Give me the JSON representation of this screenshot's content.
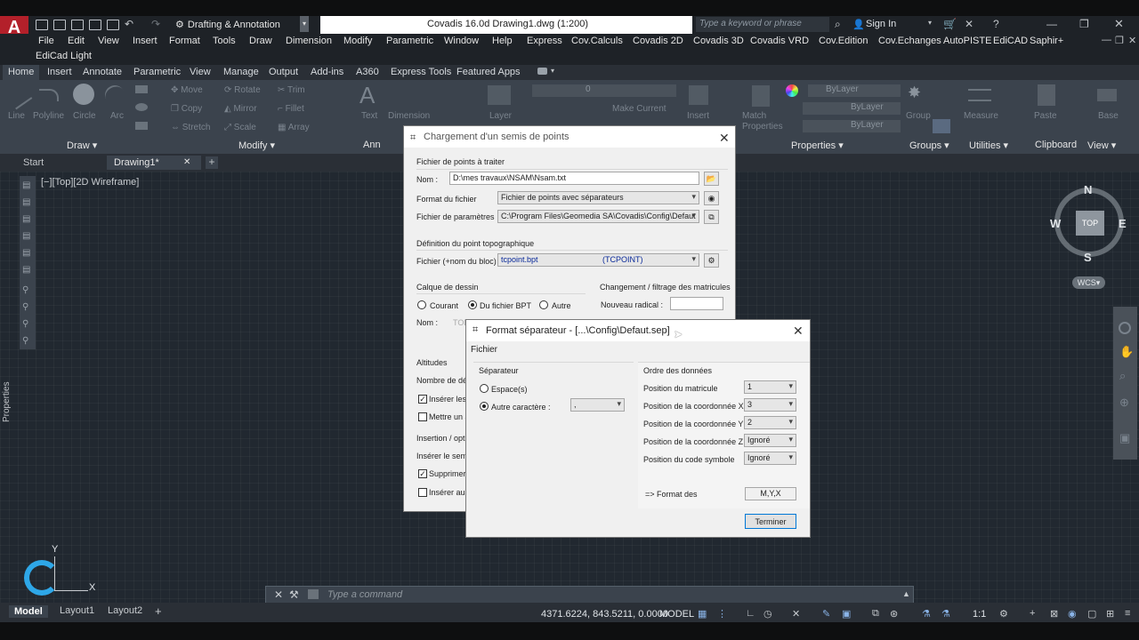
{
  "app": {
    "logo_letter": "A",
    "workspace": "Drafting & Annotation",
    "title": "Covadis 16.0d    Drawing1.dwg (1:200)",
    "search_placeholder": "Type a keyword or phrase",
    "sign_in": "Sign In"
  },
  "menu": [
    "File",
    "Edit",
    "View",
    "Insert",
    "Format",
    "Tools",
    "Draw",
    "Dimension",
    "Modify",
    "Parametric",
    "Window",
    "Help",
    "Express",
    "Cov.Calculs",
    "Covadis 2D",
    "Covadis 3D",
    "Covadis VRD",
    "Cov.Edition",
    "Cov.Echanges",
    "AutoPISTE",
    "EdiCAD",
    "Saphir+"
  ],
  "menu2": [
    "EdiCad Light"
  ],
  "ribbon_tabs": [
    "Home",
    "Insert",
    "Annotate",
    "Parametric",
    "View",
    "Manage",
    "Output",
    "Add-ins",
    "A360",
    "Express Tools",
    "Featured Apps"
  ],
  "ribbon": {
    "draw_tools": [
      "Line",
      "Polyline",
      "Circle",
      "Arc"
    ],
    "modify_tools": [
      "Move",
      "Rotate",
      "Trim",
      "Copy",
      "Mirror",
      "Fillet",
      "Stretch",
      "Scale",
      "Array"
    ],
    "layer_value": "0",
    "make_current": "Make Current",
    "bylayer": [
      "ByLayer",
      "ByLayer",
      "ByLayer"
    ],
    "groups": [
      "Draw",
      "Modify",
      "Ann",
      "Properties",
      "Groups",
      "Utilities",
      "Clipboard",
      "View"
    ],
    "tool_labels": [
      "Text",
      "Dimension",
      "Layer",
      "Insert",
      "Match Properties",
      "Group",
      "Measure",
      "Paste",
      "Base"
    ]
  },
  "file_tabs": {
    "start": "Start",
    "drawing": "Drawing1*"
  },
  "viewport_label": "[−][Top][2D Wireframe]",
  "properties_label": "Properties",
  "compass": {
    "n": "N",
    "s": "S",
    "e": "E",
    "w": "W",
    "top": "TOP",
    "wcs": "WCS"
  },
  "ucs": {
    "y": "Y",
    "x": "X"
  },
  "command": {
    "placeholder": "Type a command"
  },
  "layout_tabs": [
    "Model",
    "Layout1",
    "Layout2"
  ],
  "status": {
    "coords": "4371.6224, 843.5211, 0.0000",
    "model": "MODEL",
    "scale": "1:1"
  },
  "dialog1": {
    "title": "Chargement d'un semis de points",
    "section_file": "Fichier de points à traiter",
    "nom_label": "Nom :",
    "nom_value": "D:\\mes travaux\\NSAM\\Nsam.txt",
    "format_label": "Format du fichier",
    "format_value": "Fichier de points avec séparateurs",
    "param_label": "Fichier de paramètres",
    "param_value": "C:\\Program Files\\Geomedia SA\\Covadis\\Config\\Defaut",
    "section_def": "Définition du point topographique",
    "bloc_label": "Fichier (+nom du bloc)",
    "bloc_value": "tcpoint.bpt",
    "bloc_name": "(TCPOINT)",
    "section_calque": "Calque de dessin",
    "radio_courant": "Courant",
    "radio_bpt": "Du fichier BPT",
    "radio_autre": "Autre",
    "calque_nom_label": "Nom :",
    "calque_nom_value": "TOP",
    "section_change": "Changement / filtrage des matricules",
    "nouveau_radical": "Nouveau radical :",
    "section_altitudes": "Altitudes",
    "nombre": "Nombre de dé",
    "chk_inserer": "Insérer les",
    "chk_mettre": "Mettre un a",
    "section_insertion": "Insertion / opti",
    "inserer_sem": "Insérer le sem",
    "chk_supprimer": "Supprimer",
    "chk_inserer_aus": "Insérer aus"
  },
  "dialog2": {
    "title": "Format séparateur - [...\\Config\\Defaut.sep]",
    "menu_fichier": "Fichier",
    "section_sep": "Séparateur",
    "radio_espace": "Espace(s)",
    "radio_autre": "Autre caractère :",
    "autre_value": ",",
    "section_ordre": "Ordre des données",
    "rows": [
      {
        "label": "Position du matricule",
        "value": "1"
      },
      {
        "label": "Position de la coordonnée X",
        "value": "3"
      },
      {
        "label": "Position de la coordonnée Y",
        "value": "2"
      },
      {
        "label": "Position de la coordonnée Z",
        "value": "Ignoré"
      },
      {
        "label": "Position du code symbole",
        "value": "Ignoré"
      }
    ],
    "format_label": "=> Format des",
    "format_value": "M,Y,X",
    "terminer": "Terminer"
  },
  "colors": {
    "accent": "#0078d7",
    "logo": "#b3202a",
    "ribbon": "#3b434d",
    "canvas": "#212830"
  }
}
